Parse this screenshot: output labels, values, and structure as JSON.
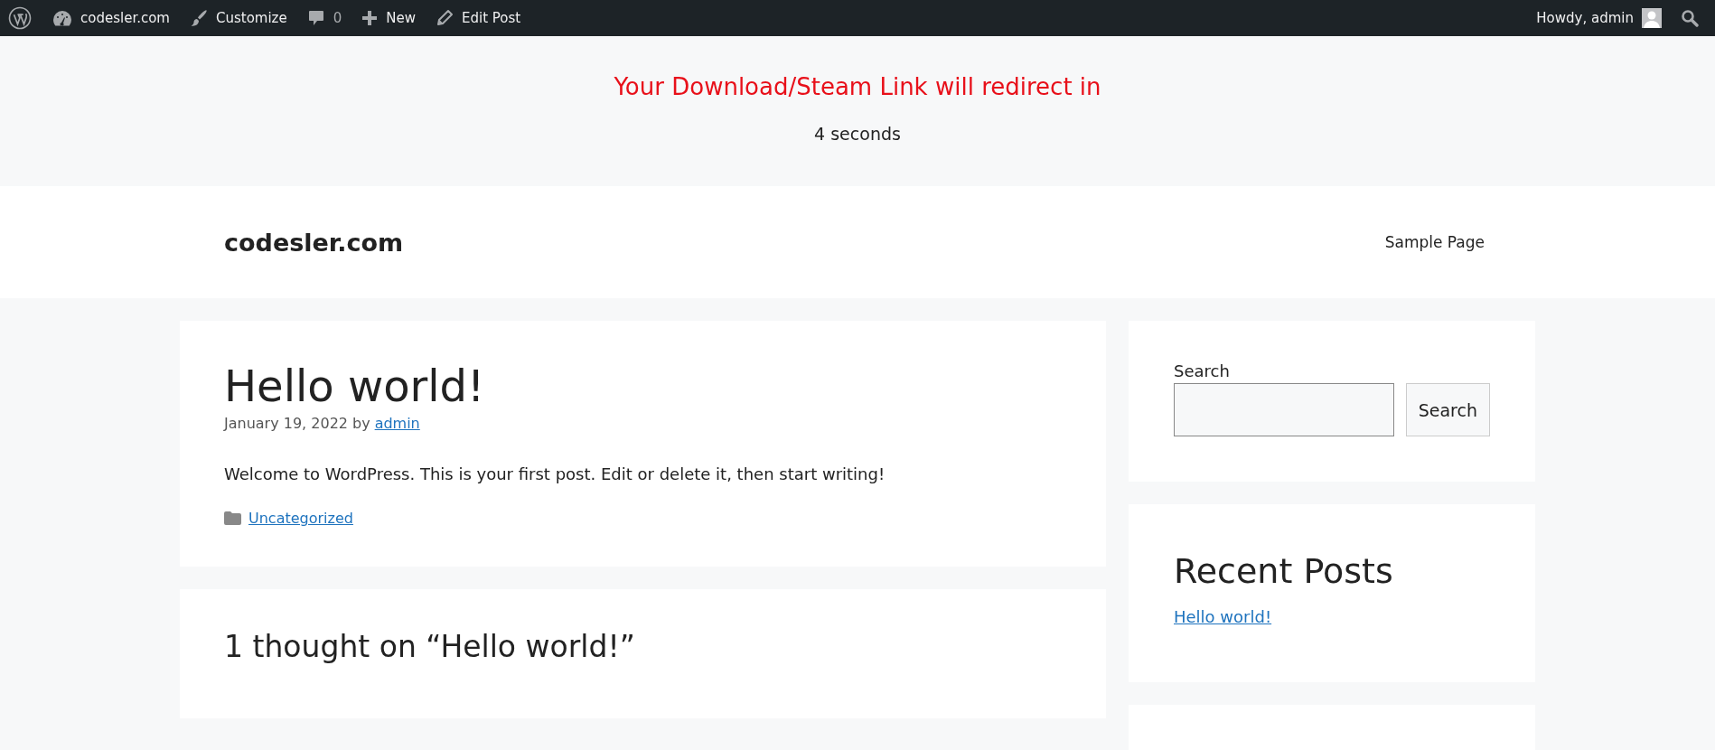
{
  "admin_bar": {
    "items": [
      {
        "kind": "site",
        "label": "codesler.com"
      },
      {
        "kind": "customize",
        "label": "Customize"
      },
      {
        "kind": "comments",
        "label": "0"
      },
      {
        "kind": "new",
        "label": "New"
      },
      {
        "kind": "edit",
        "label": "Edit Post"
      }
    ],
    "account": "Howdy, admin"
  },
  "redirect_notice": {
    "message": "Your Download/Steam Link will redirect in",
    "countdown": "4 seconds"
  },
  "site_header": {
    "title": "codesler.com",
    "nav": [
      "Sample Page"
    ]
  },
  "post": {
    "title": "Hello world!",
    "date": "January 19, 2022",
    "by": "by",
    "author": "admin",
    "body": "Welcome to WordPress. This is your first post. Edit or delete it, then start writing!",
    "category": "Uncategorized"
  },
  "comments": {
    "title": "1 thought on “Hello world!”"
  },
  "sidebar": {
    "search": {
      "label": "Search",
      "button": "Search"
    },
    "recent_posts": {
      "title": "Recent Posts",
      "links": [
        "Hello world!"
      ]
    }
  }
}
